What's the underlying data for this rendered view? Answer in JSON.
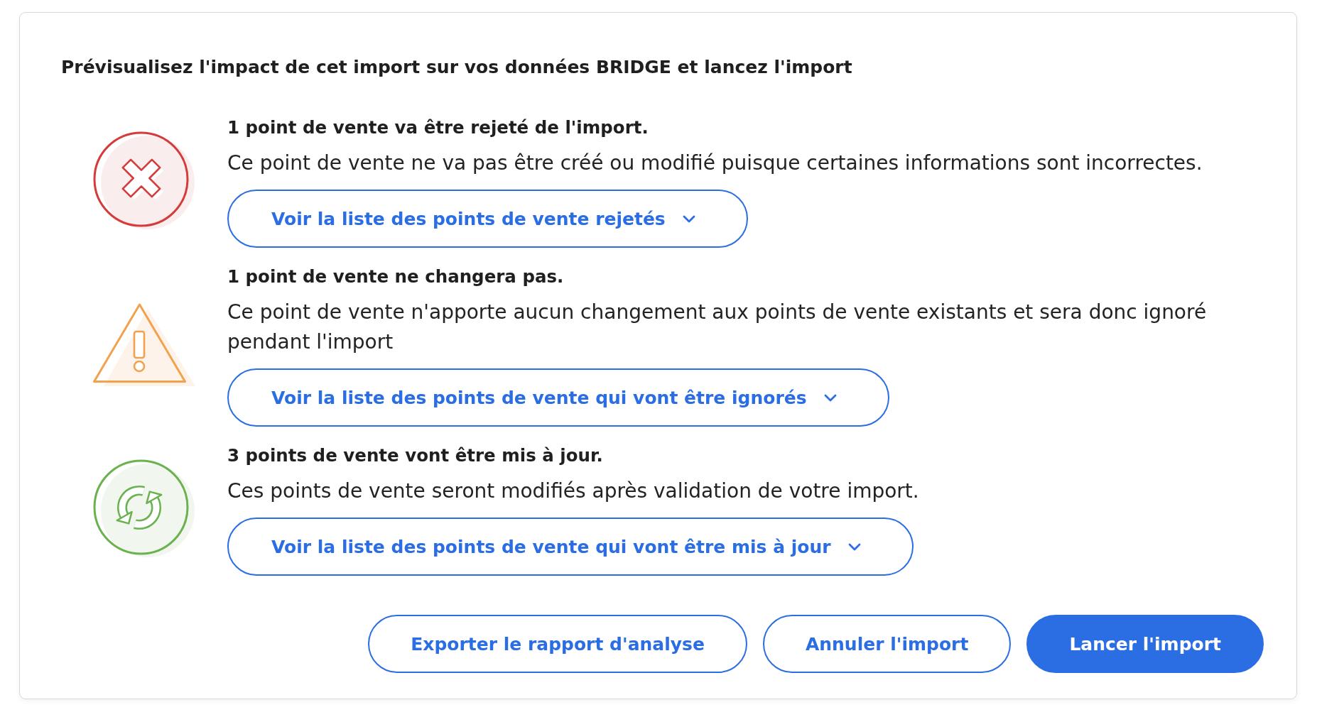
{
  "title": "Prévisualisez l'impact de cet import sur vos données BRIDGE et lancez l'import",
  "sections": [
    {
      "kind": "rejected",
      "heading": "1 point de vente va être rejeté de l'import.",
      "description": "Ce point de vente ne va pas être créé ou modifié puisque certaines informations sont incorrectes.",
      "toggle": {
        "label": "Voir la liste des points de vente rejetés",
        "expanded": false
      }
    },
    {
      "kind": "ignored",
      "heading": "1 point de vente ne changera pas.",
      "description": "Ce point de vente n'apporte aucun changement aux points de vente existants et sera donc ignoré pendant l'import",
      "toggle": {
        "label": "Voir la liste des points de vente qui vont être ignorés",
        "expanded": false
      }
    },
    {
      "kind": "updated",
      "heading": "3 points de vente vont être mis à jour.",
      "description": "Ces points de vente seront modifiés après validation de votre import.",
      "toggle": {
        "label": "Voir la liste des points de vente qui vont être mis à jour",
        "expanded": false
      }
    }
  ],
  "actions": [
    {
      "label": "Exporter le rapport d'analyse",
      "kind": "secondary"
    },
    {
      "label": "Annuler l'import",
      "kind": "secondary"
    },
    {
      "label": "Lancer l'import",
      "kind": "primary"
    }
  ]
}
